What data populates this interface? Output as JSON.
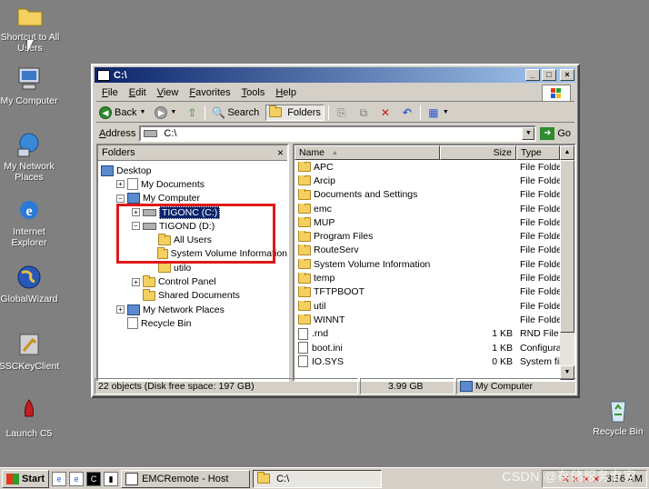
{
  "desktop": {
    "icons": [
      {
        "label": "Shortcut to All Users",
        "icon": "folder-icon"
      },
      {
        "label": "My Computer",
        "icon": "computer-icon"
      },
      {
        "label": "My Network Places",
        "icon": "network-icon"
      },
      {
        "label": "Internet Explorer",
        "icon": "ie-icon"
      },
      {
        "label": "GlobalWizard",
        "icon": "globe-icon"
      },
      {
        "label": "SSCKeyClient",
        "icon": "key-icon"
      },
      {
        "label": "Launch C5",
        "icon": "rocket-icon"
      },
      {
        "label": "Recycle Bin",
        "icon": "recycle-bin-icon"
      }
    ]
  },
  "window": {
    "title": "C:\\",
    "menu": [
      "File",
      "Edit",
      "View",
      "Favorites",
      "Tools",
      "Help"
    ],
    "toolbar": {
      "back": "Back",
      "search": "Search",
      "folders": "Folders"
    },
    "address": {
      "label": "Address",
      "value": "C:\\",
      "go": "Go"
    },
    "folders_pane": {
      "title": "Folders",
      "close": "×",
      "tree": [
        {
          "label": "Desktop",
          "level": 0,
          "expander": "",
          "icon": "desktop"
        },
        {
          "label": "My Documents",
          "level": 1,
          "expander": "+",
          "icon": "doc"
        },
        {
          "label": "My Computer",
          "level": 1,
          "expander": "-",
          "icon": "pc"
        },
        {
          "label": "TIGONC (C:)",
          "level": 2,
          "expander": "+",
          "icon": "drive",
          "selected": true
        },
        {
          "label": "TIGOND (D:)",
          "level": 2,
          "expander": "-",
          "icon": "drive"
        },
        {
          "label": "All Users",
          "level": 3,
          "expander": "",
          "icon": "folder"
        },
        {
          "label": "System Volume Information",
          "level": 3,
          "expander": "",
          "icon": "folder"
        },
        {
          "label": "utilo",
          "level": 3,
          "expander": "",
          "icon": "folder"
        },
        {
          "label": "Control Panel",
          "level": 2,
          "expander": "+",
          "icon": "folder"
        },
        {
          "label": "Shared Documents",
          "level": 2,
          "expander": "",
          "icon": "folder"
        },
        {
          "label": "My Network Places",
          "level": 1,
          "expander": "+",
          "icon": "pc"
        },
        {
          "label": "Recycle Bin",
          "level": 1,
          "expander": "",
          "icon": "doc"
        }
      ]
    },
    "files_pane": {
      "columns": {
        "name": "Name",
        "size": "Size",
        "type": "Type"
      },
      "rows": [
        {
          "name": "APC",
          "size": "",
          "type": "File Folder",
          "icon": "folder"
        },
        {
          "name": "Arcip",
          "size": "",
          "type": "File Folder",
          "icon": "folder"
        },
        {
          "name": "Documents and Settings",
          "size": "",
          "type": "File Folder",
          "icon": "folder"
        },
        {
          "name": "emc",
          "size": "",
          "type": "File Folder",
          "icon": "folder"
        },
        {
          "name": "MUP",
          "size": "",
          "type": "File Folder",
          "icon": "folder"
        },
        {
          "name": "Program Files",
          "size": "",
          "type": "File Folder",
          "icon": "folder"
        },
        {
          "name": "RouteServ",
          "size": "",
          "type": "File Folder",
          "icon": "folder"
        },
        {
          "name": "System Volume Information",
          "size": "",
          "type": "File Folder",
          "icon": "folder"
        },
        {
          "name": "temp",
          "size": "",
          "type": "File Folder",
          "icon": "folder"
        },
        {
          "name": "TFTPBOOT",
          "size": "",
          "type": "File Folder",
          "icon": "folder"
        },
        {
          "name": "util",
          "size": "",
          "type": "File Folder",
          "icon": "folder"
        },
        {
          "name": "WINNT",
          "size": "",
          "type": "File Folder",
          "icon": "folder"
        },
        {
          "name": ".rnd",
          "size": "1 KB",
          "type": "RND File",
          "icon": "file"
        },
        {
          "name": "boot.ini",
          "size": "1 KB",
          "type": "Configurat",
          "icon": "file"
        },
        {
          "name": "IO.SYS",
          "size": "0 KB",
          "type": "System file",
          "icon": "file"
        }
      ]
    },
    "status": {
      "objects": "22 objects (Disk free space: 197 GB)",
      "size": "3.99 GB",
      "location": "My Computer"
    }
  },
  "taskbar": {
    "start": "Start",
    "tasks": [
      {
        "label": "EMCRemote - Host",
        "active": false
      },
      {
        "label": "C:\\",
        "active": true
      }
    ],
    "clock": "3:16 AM"
  },
  "watermark": "CSDN @存储服务专家"
}
